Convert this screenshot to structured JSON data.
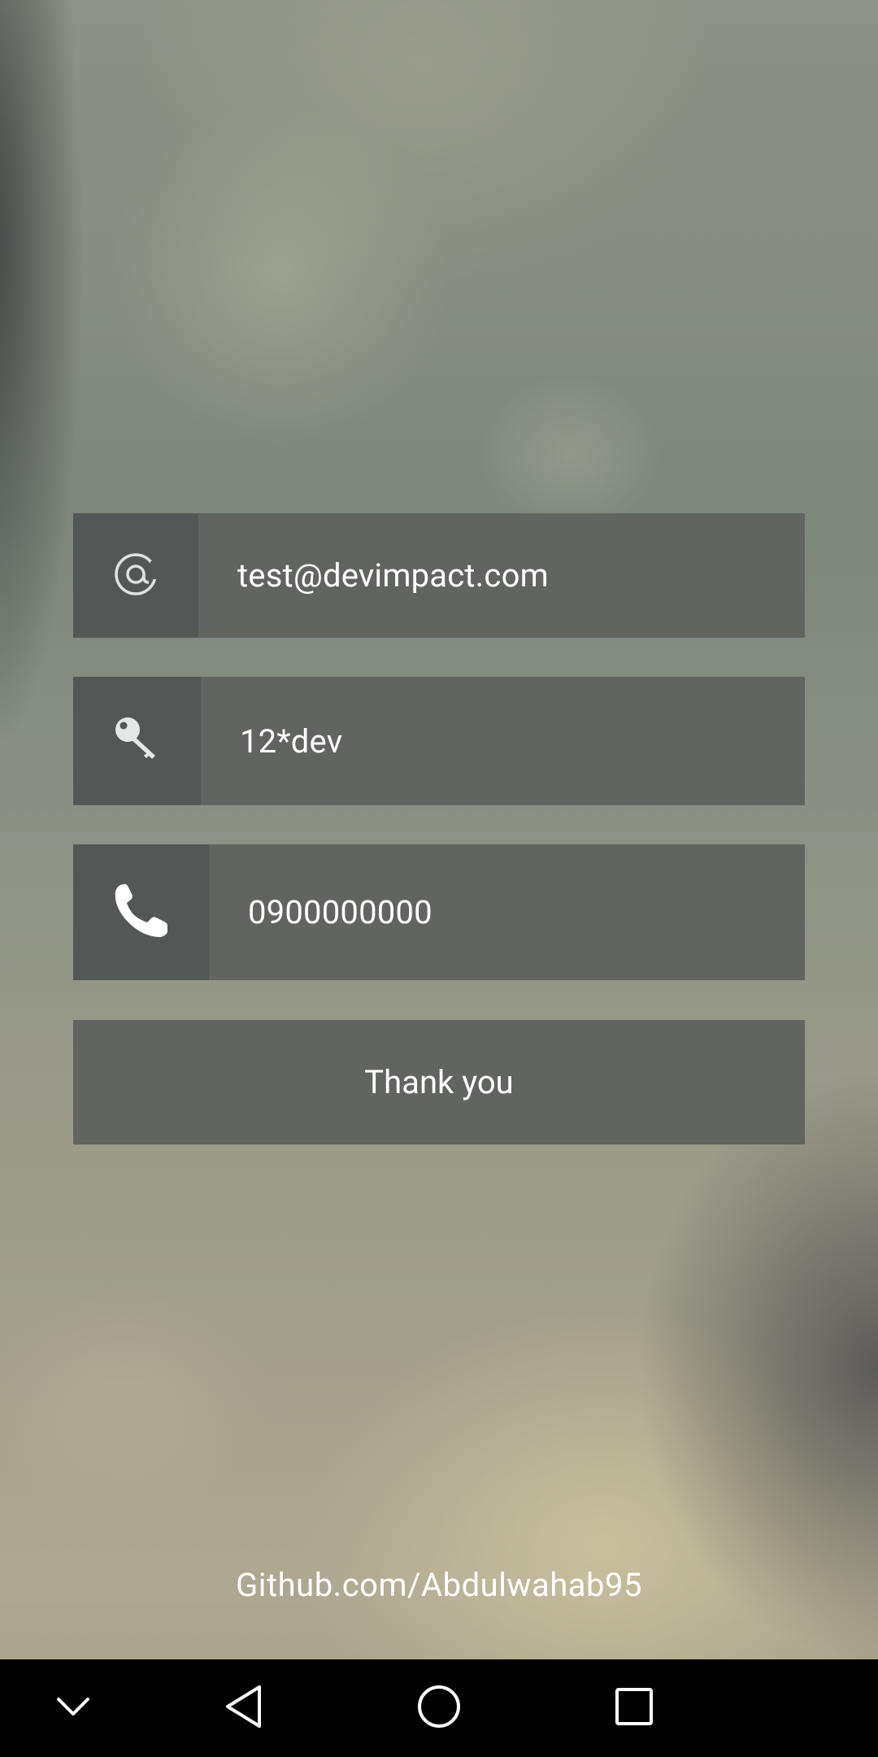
{
  "form": {
    "email": {
      "icon": "at-sign-icon",
      "value": "test@devimpact.com"
    },
    "password": {
      "icon": "key-icon",
      "value": "12*dev"
    },
    "phone": {
      "icon": "phone-icon",
      "value": "0900000000"
    },
    "submit_label": "Thank you"
  },
  "footer": {
    "link_text": "Github.com/Abdulwahab95"
  },
  "navbar": {
    "items": [
      "collapse-icon",
      "back-icon",
      "home-icon",
      "recents-icon"
    ]
  },
  "colors": {
    "field_bg": "#626462",
    "icon_cell_bg": "#535857",
    "text": "#ffffff",
    "navbar_bg": "#000000"
  }
}
